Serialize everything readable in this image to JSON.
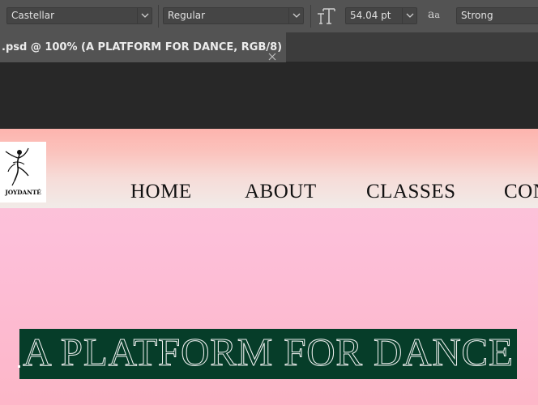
{
  "options_bar": {
    "font_family": "Castellar",
    "font_style": "Regular",
    "font_size": "54.04 pt",
    "aa_label": "a",
    "aa_label_small": "a",
    "anti_alias": "Strong"
  },
  "tab": {
    "title": ".psd @ 100% (A PLATFORM FOR DANCE, RGB/8) *"
  },
  "site": {
    "logo_text": "JOYDANTÉ",
    "nav": [
      "HOME",
      "ABOUT",
      "CLASSES",
      "CON"
    ],
    "headline": "A PLATFORM FOR DANCE"
  },
  "colors": {
    "headline_bg": "#063d29",
    "header_gradient_top": "#fdb4ae",
    "canvas_pink": "#fbc7da",
    "ui_panel": "#535353"
  }
}
